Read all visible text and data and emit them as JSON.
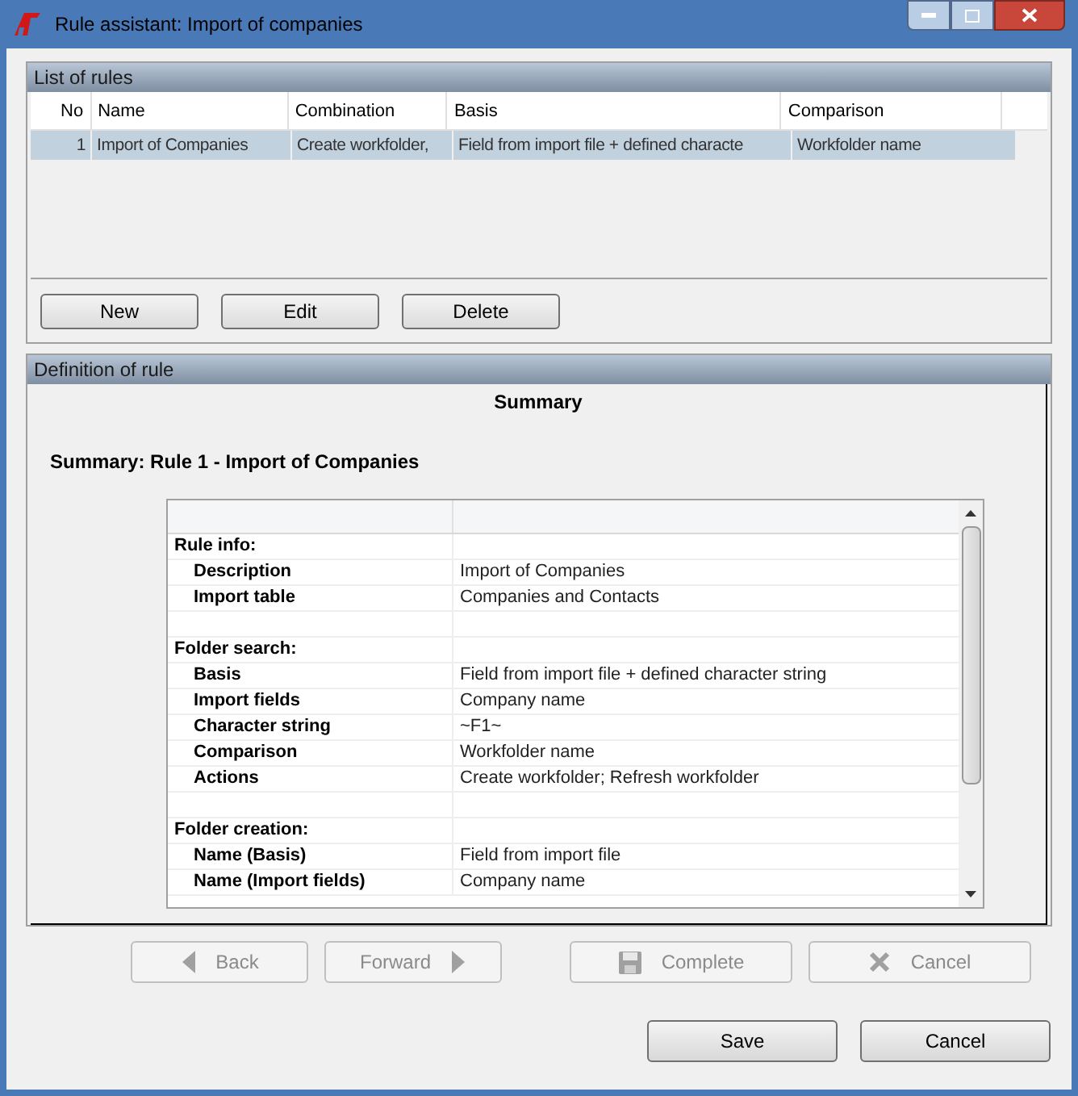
{
  "window": {
    "title": "Rule assistant: Import of companies"
  },
  "rules_panel": {
    "title": "List of rules",
    "columns": [
      "No",
      "Name",
      "Combination",
      "Basis",
      "Comparison"
    ],
    "rows": [
      {
        "cells": [
          "1",
          "Import of Companies",
          "Create workfolder,",
          "Field from import file + defined characte",
          "Workfolder name"
        ],
        "selected": true
      }
    ],
    "buttons": [
      "New",
      "Edit",
      "Delete"
    ]
  },
  "definition_panel": {
    "title": "Definition of rule",
    "heading": "Summary",
    "subheading": "Summary: Rule 1 - Import of Companies",
    "rows": [
      {
        "kind": "section",
        "label": "Rule info:"
      },
      {
        "kind": "field",
        "label": "Description",
        "value": "Import of Companies"
      },
      {
        "kind": "field",
        "label": "Import table",
        "value": "Companies and Contacts"
      },
      {
        "kind": "blank"
      },
      {
        "kind": "section",
        "label": "Folder search:"
      },
      {
        "kind": "field",
        "label": "Basis",
        "value": "Field from import file + defined character string"
      },
      {
        "kind": "field",
        "label": "Import fields",
        "value": "Company name"
      },
      {
        "kind": "field",
        "label": "Character string",
        "value": "~F1~"
      },
      {
        "kind": "field",
        "label": "Comparison",
        "value": "Workfolder name"
      },
      {
        "kind": "field",
        "label": "Actions",
        "value": "Create workfolder; Refresh workfolder"
      },
      {
        "kind": "blank"
      },
      {
        "kind": "section",
        "label": "Folder creation:"
      },
      {
        "kind": "field",
        "label": "Name (Basis)",
        "value": "Field from import file"
      },
      {
        "kind": "field",
        "label": "Name (Import fields)",
        "value": "Company name"
      }
    ],
    "nav_buttons": [
      {
        "kind": "back",
        "label": "Back",
        "disabled": true
      },
      {
        "kind": "forward",
        "label": "Forward",
        "disabled": true
      },
      {
        "kind": "complete",
        "label": "Complete",
        "disabled": true
      },
      {
        "kind": "cancel",
        "label": "Cancel",
        "disabled": true
      }
    ]
  },
  "footer_buttons": [
    "Save",
    "Cancel"
  ]
}
